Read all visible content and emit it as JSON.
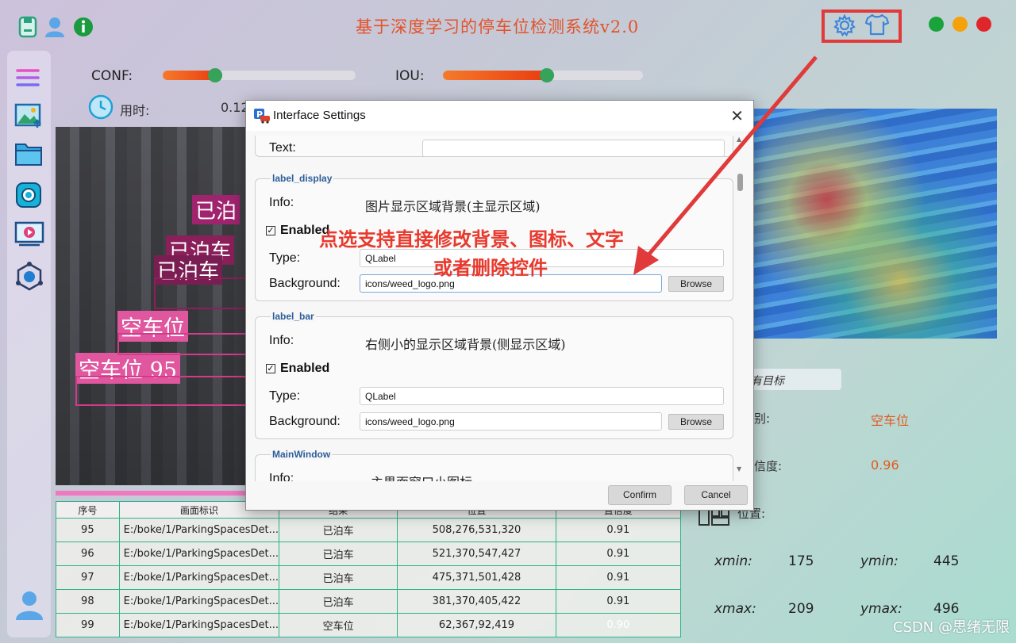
{
  "app": {
    "title": "基于深度学习的停车位检测系统v2.0",
    "colors": {
      "close": "#e0262a",
      "minimize": "#f5a10a",
      "maximize": "#1aa33a",
      "accent": "#e2532a"
    }
  },
  "toolbar_icons": [
    "save-icon",
    "user-icon",
    "info-icon"
  ],
  "header_icons": [
    "settings-gear-icon",
    "theme-shirt-icon"
  ],
  "sidebar": {
    "icons": [
      "menu-icon",
      "image-icon",
      "folder-icon",
      "camera-icon",
      "video-icon",
      "model-icon",
      "avatar-icon"
    ]
  },
  "sliders": {
    "conf": {
      "label": "CONF:",
      "value": 0.27
    },
    "iou": {
      "label": "IOU:",
      "value": 0.52
    }
  },
  "timing": {
    "label": "用时:",
    "value": "0.12"
  },
  "overlays": [
    {
      "text": "已泊"
    },
    {
      "text": "已泊车"
    },
    {
      "text": "已泊车"
    },
    {
      "text": "空车位"
    },
    {
      "text": "空车位 95"
    }
  ],
  "table": {
    "headers": [
      "序号",
      "画面标识",
      "结果",
      "位置",
      "置信度"
    ],
    "rows": [
      [
        "95",
        "E:/boke/1/ParkingSpacesDet...",
        "已泊车",
        "508,276,531,320",
        "0.91"
      ],
      [
        "96",
        "E:/boke/1/ParkingSpacesDet...",
        "已泊车",
        "521,370,547,427",
        "0.91"
      ],
      [
        "97",
        "E:/boke/1/ParkingSpacesDet...",
        "已泊车",
        "475,371,501,428",
        "0.91"
      ],
      [
        "98",
        "E:/boke/1/ParkingSpacesDet...",
        "已泊车",
        "381,370,405,422",
        "0.91"
      ],
      [
        "99",
        "E:/boke/1/ParkingSpacesDet...",
        "空车位",
        "62,367,92,419",
        "0.90"
      ]
    ]
  },
  "result_panel": {
    "target_select": "有目标",
    "class_label": "别:",
    "class_value": "空车位",
    "conf_label": "信度:",
    "conf_value": "0.96",
    "pos_label": "位置:",
    "xmin_label": "xmin:",
    "xmin": "175",
    "ymin_label": "ymin:",
    "ymin": "445",
    "xmax_label": "xmax:",
    "xmax": "209",
    "ymax_label": "ymax:",
    "ymax": "496"
  },
  "dialog": {
    "title": "Interface Settings",
    "close": "✕",
    "text_label": "Text:",
    "groups": [
      {
        "name": "label_display",
        "info_label": "Info:",
        "info": "图片显示区域背景(主显示区域)",
        "enabled_label": "Enabled",
        "type_label": "Type:",
        "type": "QLabel",
        "bg_label": "Background:",
        "bg": "icons/weed_logo.png",
        "browse": "Browse"
      },
      {
        "name": "label_bar",
        "info_label": "Info:",
        "info": "右侧小的显示区域背景(侧显示区域)",
        "enabled_label": "Enabled",
        "type_label": "Type:",
        "type": "QLabel",
        "bg_label": "Background:",
        "bg": "icons/weed_logo.png",
        "browse": "Browse"
      },
      {
        "name": "MainWindow",
        "info_label": "Info:",
        "info": "主界面窗口小图标"
      }
    ],
    "confirm": "Confirm",
    "cancel": "Cancel"
  },
  "annotation": {
    "line1": "点选支持直接修改背景、图标、文字",
    "line2": "或者删除控件"
  },
  "watermark": "CSDN @思绪无限"
}
